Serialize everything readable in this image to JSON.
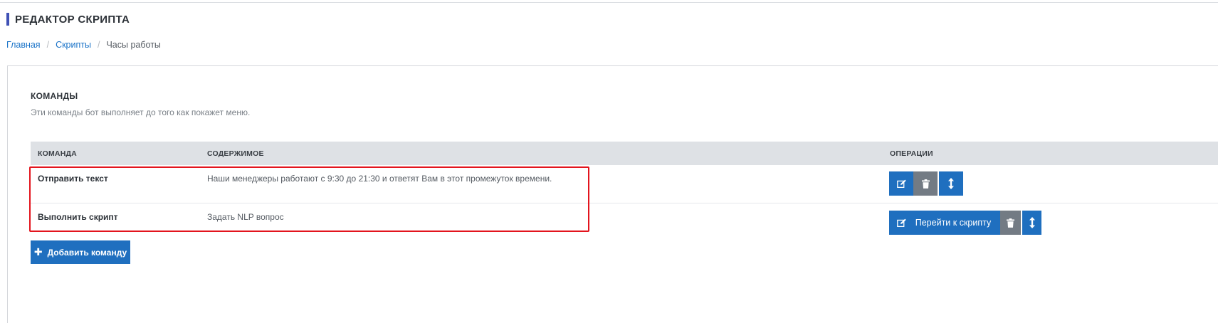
{
  "header": {
    "title": "РЕДАКТОР СКРИПТА"
  },
  "breadcrumb": {
    "items": [
      {
        "label": "Главная"
      },
      {
        "label": "Скрипты"
      },
      {
        "label": "Часы работы"
      }
    ],
    "separator": "/"
  },
  "commands": {
    "title": "КОМАНДЫ",
    "description": "Эти команды бот выполняет до того как покажет меню.",
    "columns": {
      "command": "КОМАНДА",
      "content": "СОДЕРЖИМОЕ",
      "operations": "ОПЕРАЦИИ"
    },
    "rows": [
      {
        "command": "Отправить текст",
        "content": "Наши менеджеры работают с 9:30 до 21:30 и ответят Вам в этот промежуток времени."
      },
      {
        "command": "Выполнить скрипт",
        "content": "Задать NLP вопрос",
        "go_label": "Перейти к скрипту"
      }
    ],
    "add_button_label": "Добавить команду"
  },
  "icons": {
    "edit": "edit-icon",
    "delete": "trash-icon",
    "move": "vertical-arrows-icon",
    "add": "plus-icon"
  },
  "colors": {
    "accent": "#3f51b5",
    "primary_button": "#1f6fbf",
    "secondary_button": "#737b84",
    "highlight": "#e3141d",
    "link": "#1a73c8"
  }
}
